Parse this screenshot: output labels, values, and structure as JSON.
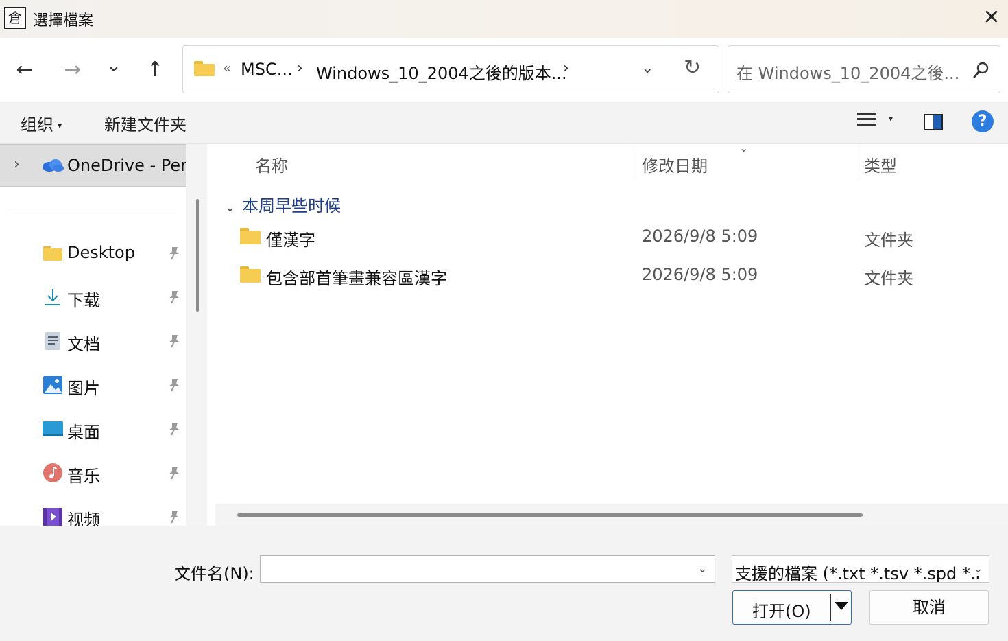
{
  "window": {
    "app_icon_glyph": "倉",
    "title": "選擇檔案",
    "close_glyph": "✕"
  },
  "nav": {
    "back_glyph": "←",
    "forward_glyph": "→",
    "recent_glyph": "⌄",
    "up_glyph": "↑",
    "breadcrumb_overflow": "«",
    "breadcrumb": [
      "MSC...",
      "Windows_10_2004之後的版本..."
    ],
    "sep_glyph": "›",
    "dropdown_glyph": "⌄",
    "refresh_glyph": "↻",
    "search_placeholder": "在 Windows_10_2004之後..."
  },
  "toolbar": {
    "organize_label": "组织",
    "new_folder_label": "新建文件夹",
    "help_glyph": "?"
  },
  "sidebar": {
    "onedrive_label": "OneDrive - Per:",
    "items": [
      {
        "label": "Desktop",
        "icon": "folder-icon"
      },
      {
        "label": "下载",
        "icon": "download-icon"
      },
      {
        "label": "文档",
        "icon": "document-icon"
      },
      {
        "label": "图片",
        "icon": "pictures-icon"
      },
      {
        "label": "桌面",
        "icon": "desktop-icon"
      },
      {
        "label": "音乐",
        "icon": "music-icon"
      },
      {
        "label": "视频",
        "icon": "video-icon"
      }
    ]
  },
  "filelist": {
    "columns": {
      "name": "名称",
      "date": "修改日期",
      "type": "类型"
    },
    "group_label": "本周早些时候",
    "rows": [
      {
        "name": "僅漢字",
        "date": "2026/9/8 5:09",
        "type": "文件夹"
      },
      {
        "name": "包含部首筆畫兼容區漢字",
        "date": "2026/9/8 5:09",
        "type": "文件夹"
      }
    ]
  },
  "bottom": {
    "filename_label": "文件名(N):",
    "filename_value": "",
    "filetype_value": "支援的檔案 (*.txt *.tsv *.spd *.l",
    "open_label": "打开(O)",
    "cancel_label": "取消"
  },
  "colors": {
    "accent": "#2f6fc7",
    "folder": "#f6cc52",
    "group_header": "#1e3f8a"
  }
}
